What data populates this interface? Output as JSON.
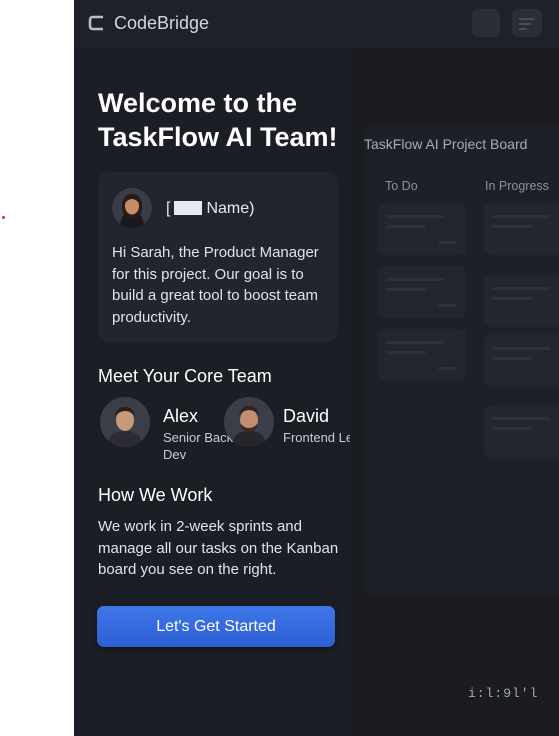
{
  "brand": {
    "name": "CodeBridge"
  },
  "welcome": {
    "title": "Welcome to the TaskFlow AI Team!"
  },
  "intro": {
    "name_prefix": "[",
    "name_suffix": "Name)",
    "message": "Hi Sarah, the Product Manager for this project. Our goal is to build a great tool to boost team productivity."
  },
  "team": {
    "heading": "Meet Your Core Team",
    "members": [
      {
        "name": "Alex",
        "role": "Senior Backend Dev"
      },
      {
        "name": "David",
        "role": "Frontend Lead"
      }
    ]
  },
  "how": {
    "heading": "How We Work",
    "text": "We work in 2-week sprints and manage all our tasks on the Kanban board you see on the right."
  },
  "cta": {
    "label": "Let's Get Started"
  },
  "board": {
    "title": "TaskFlow AI Project Board",
    "columns": [
      "To Do",
      "In Progress"
    ]
  },
  "footer": {
    "mark": "i:l:9l'l"
  },
  "colors": {
    "accent": "#2f64d8",
    "background": "#1b1d24"
  },
  "icons": [
    "codebridge-logo-icon",
    "menu-icon"
  ]
}
